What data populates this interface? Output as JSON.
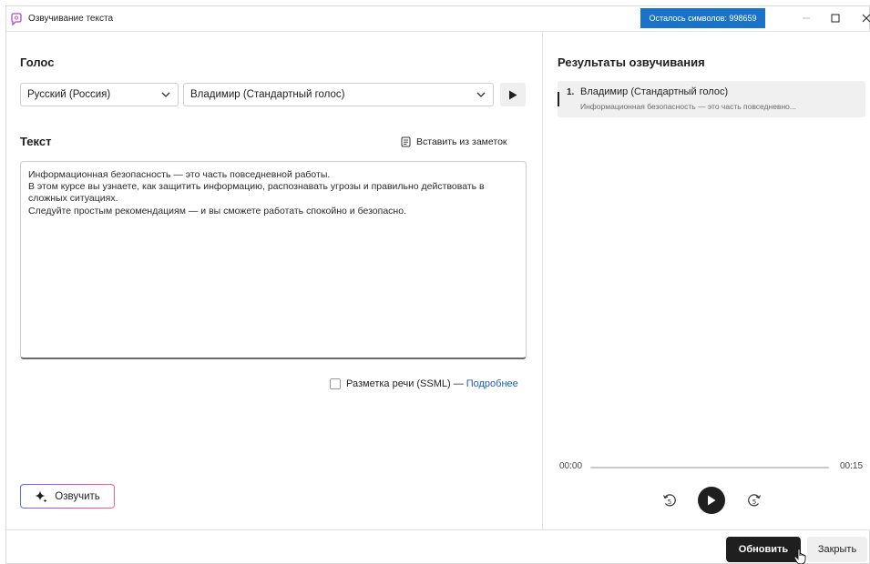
{
  "window": {
    "title": "Озвучивание текста",
    "chars_left": "Осталось символов: 998659"
  },
  "voice": {
    "heading": "Голос",
    "language": "Русский (Россия)",
    "voice_name": "Владимир (Стандартный голос)"
  },
  "text_section": {
    "heading": "Текст",
    "paste_label": "Вставить из заметок",
    "lines": [
      "Информационная безопасность — это часть повседневной работы.",
      "В этом курсе вы узнаете, как защитить информацию, распознавать угрозы и правильно действовать в сложных ситуациях.",
      "Следуйте простым рекомендациям — и вы сможете работать спокойно и безопасно."
    ],
    "ssml_label": "Разметка речи (SSML) —",
    "ssml_link": "Подробнее"
  },
  "speak_button": "Озвучить",
  "results": {
    "heading": "Результаты озвучивания",
    "items": [
      {
        "num": "1.",
        "title": "Владимир (Стандартный голос)",
        "preview": "Информационная безопасность — это часть повседневно..."
      }
    ]
  },
  "player": {
    "current": "00:00",
    "duration": "00:15",
    "progress": 0
  },
  "footer": {
    "update": "Обновить",
    "close": "Закрыть"
  },
  "colors": {
    "accent": "#1a73c9",
    "dark": "#1f1f1f",
    "link": "#1a5fb4"
  }
}
